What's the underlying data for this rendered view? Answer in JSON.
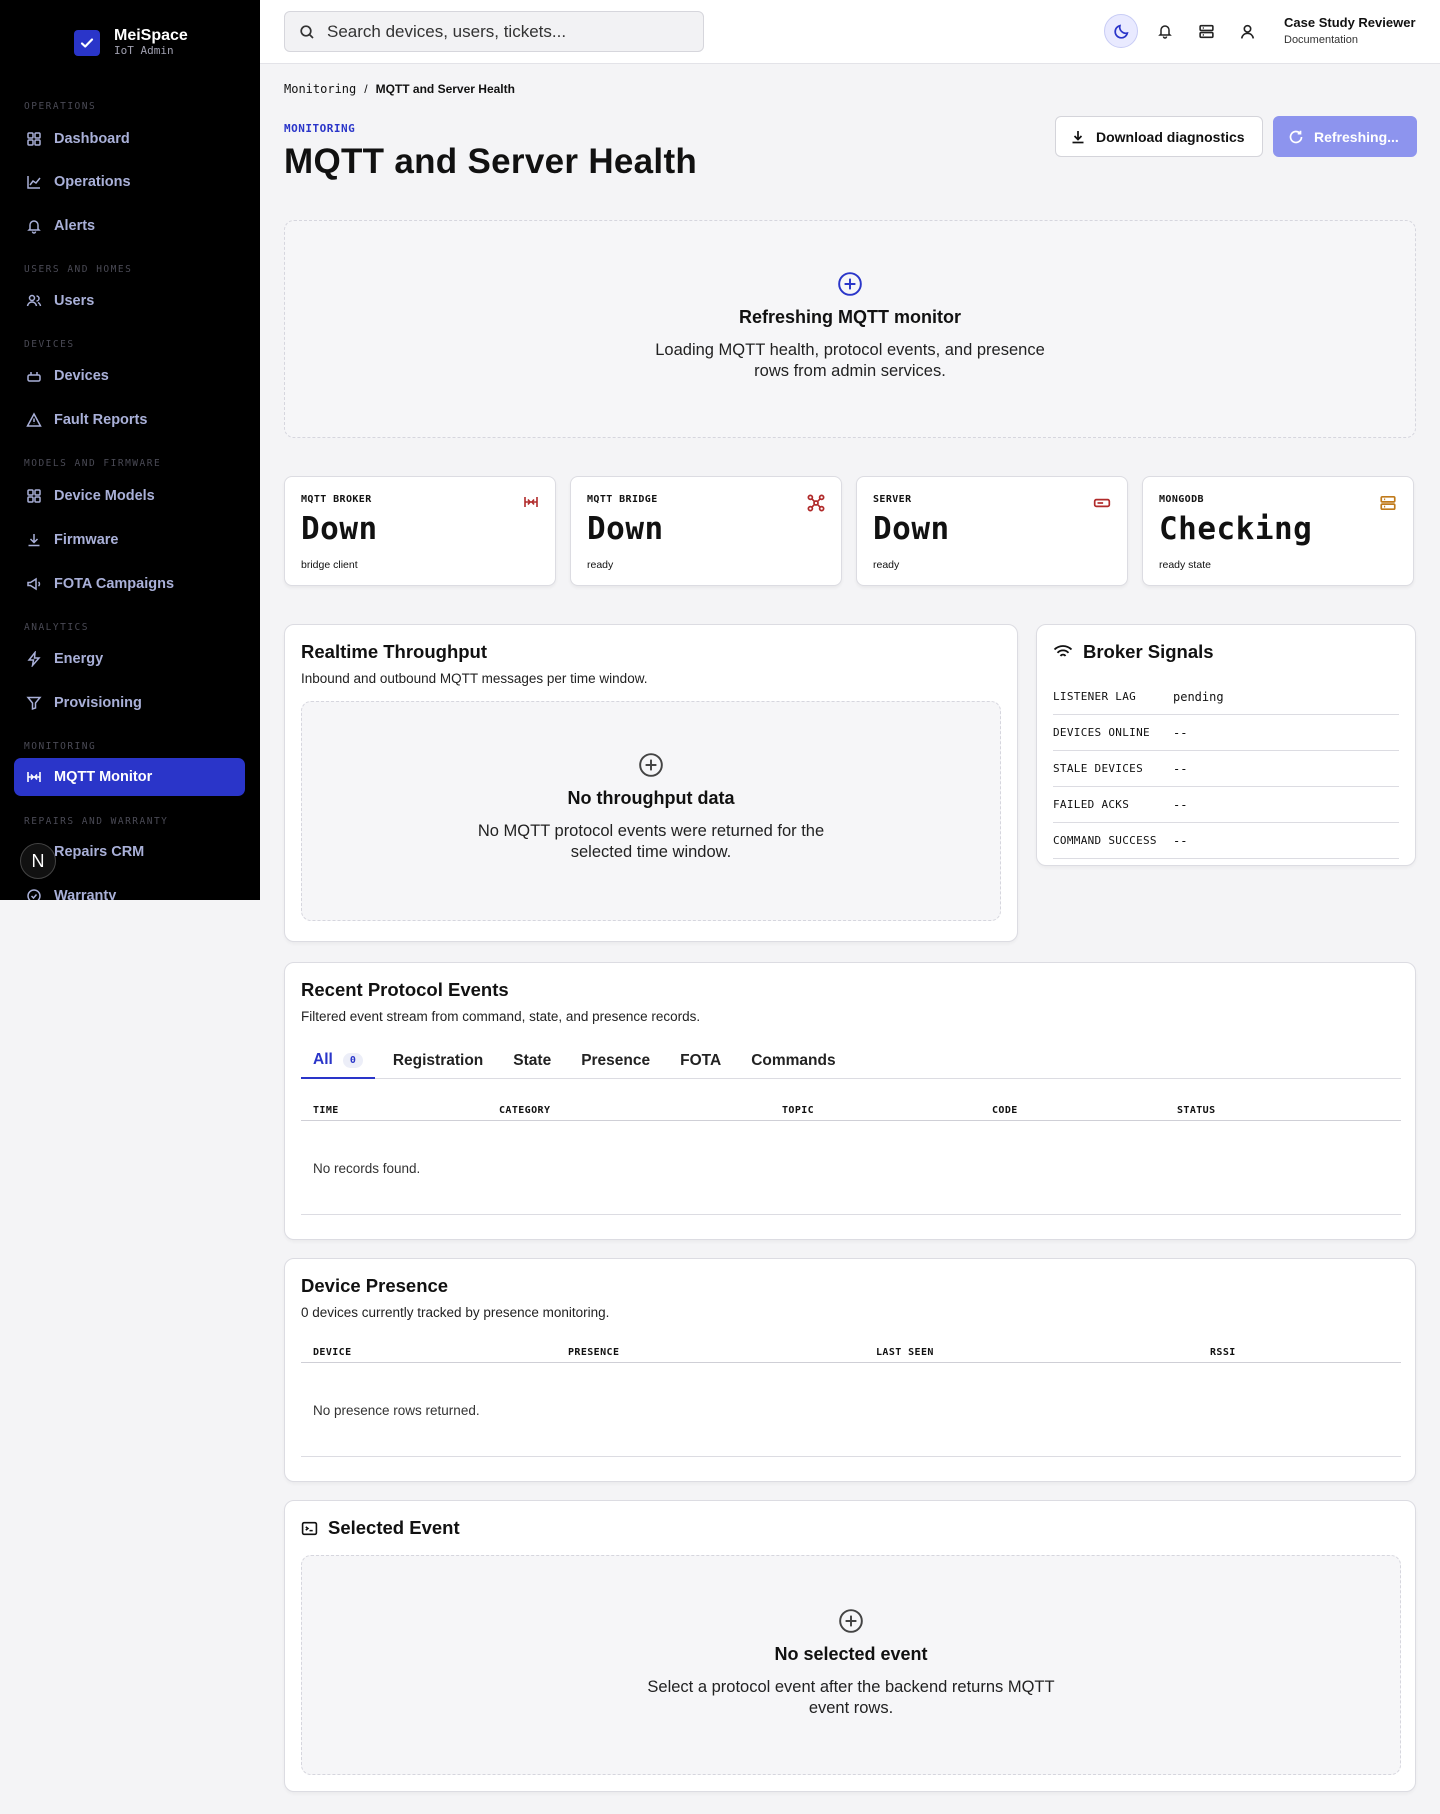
{
  "brand": {
    "name": "MeiSpace",
    "sub": "IoT Admin"
  },
  "nav": {
    "sections": {
      "operations": "OPERATIONS",
      "users": "USERS AND HOMES",
      "devices": "DEVICES",
      "models": "MODELS AND FIRMWARE",
      "analytics": "ANALYTICS",
      "monitoring": "MONITORING",
      "repairs": "REPAIRS AND WARRANTY"
    },
    "items": {
      "dashboard": "Dashboard",
      "operations": "Operations",
      "alerts": "Alerts",
      "users": "Users",
      "devices": "Devices",
      "fault_reports": "Fault Reports",
      "device_models": "Device Models",
      "firmware": "Firmware",
      "fota": "FOTA Campaigns",
      "energy": "Energy",
      "provisioning": "Provisioning",
      "mqtt_monitor": "MQTT Monitor",
      "repairs_crm": "Repairs CRM",
      "warranty": "Warranty"
    },
    "avatar_letter": "N"
  },
  "topbar": {
    "search_placeholder": "Search devices, users, tickets...",
    "user_name": "Case Study Reviewer",
    "user_role": "Documentation"
  },
  "page": {
    "breadcrumb_root": "Monitoring",
    "breadcrumb_sep": "/",
    "breadcrumb_current": "MQTT and Server Health",
    "eyebrow": "MONITORING",
    "title": "MQTT and Server Health",
    "download_label": "Download diagnostics",
    "refresh_label": "Refreshing..."
  },
  "loading": {
    "title": "Refreshing MQTT monitor",
    "desc": "Loading MQTT health, protocol events, and presence rows from admin services."
  },
  "stats": [
    {
      "label": "MQTT BROKER",
      "value": "Down",
      "sub": "bridge client",
      "color": "#b02a2a"
    },
    {
      "label": "MQTT BRIDGE",
      "value": "Down",
      "sub": "ready",
      "color": "#b02a2a"
    },
    {
      "label": "SERVER",
      "value": "Down",
      "sub": "ready",
      "color": "#b02a2a"
    },
    {
      "label": "MONGODB",
      "value": "Checking",
      "sub": "ready state",
      "color": "#c07a1a"
    }
  ],
  "throughput": {
    "title": "Realtime Throughput",
    "sub": "Inbound and outbound MQTT messages per time window.",
    "empty_title": "No throughput data",
    "empty_desc": "No MQTT protocol events were returned for the selected time window."
  },
  "signals": {
    "title": "Broker Signals",
    "rows": [
      {
        "label": "LISTENER LAG",
        "value": "pending"
      },
      {
        "label": "DEVICES ONLINE",
        "value": "--"
      },
      {
        "label": "STALE DEVICES",
        "value": "--"
      },
      {
        "label": "FAILED ACKS",
        "value": "--"
      },
      {
        "label": "COMMAND SUCCESS",
        "value": "--"
      }
    ]
  },
  "events": {
    "title": "Recent Protocol Events",
    "sub": "Filtered event stream from command, state, and presence records.",
    "tabs": [
      "All",
      "Registration",
      "State",
      "Presence",
      "FOTA",
      "Commands"
    ],
    "all_count": "0",
    "columns": [
      "TIME",
      "CATEGORY",
      "TOPIC",
      "CODE",
      "STATUS"
    ],
    "empty": "No records found."
  },
  "presence": {
    "title": "Device Presence",
    "sub": "0 devices currently tracked by presence monitoring.",
    "columns": [
      "DEVICE",
      "PRESENCE",
      "LAST SEEN",
      "RSSI"
    ],
    "empty": "No presence rows returned."
  },
  "selected": {
    "title": "Selected Event",
    "empty_title": "No selected event",
    "empty_desc": "Select a protocol event after the backend returns MQTT event rows."
  },
  "colors": {
    "accent": "#2a35c9",
    "accent_muted": "#8d94ee",
    "down": "#b02a2a",
    "warn": "#c07a1a"
  }
}
